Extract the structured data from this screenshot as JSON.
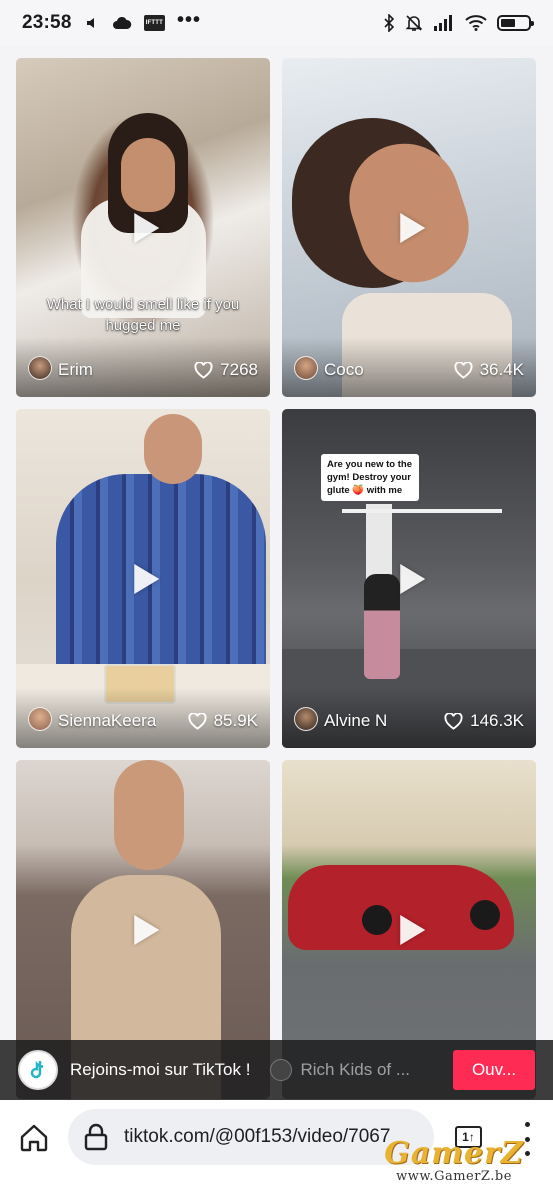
{
  "status_bar": {
    "time": "23:58",
    "ifttt_label": "IFTTT",
    "more": "•••",
    "battery_level": 0.55,
    "left_icons": [
      "volume-muted-icon",
      "cloud-icon",
      "ifttt-icon",
      "more-icon"
    ],
    "right_icons": [
      "bluetooth-icon",
      "bell-off-icon",
      "signal-icon",
      "wifi-icon",
      "battery-icon"
    ]
  },
  "videos": [
    {
      "username": "Erim",
      "likes": "7268",
      "caption": "What I would smell like if you hugged me",
      "colors": [
        "#c7b29b",
        "#e6ddd2",
        "#3b2e26"
      ]
    },
    {
      "username": "Coco",
      "likes": "36.4K",
      "caption": "",
      "colors": [
        "#d8dde3",
        "#b8876c",
        "#5a3a2a"
      ]
    },
    {
      "username": "SiennaKeera",
      "likes": "85.9K",
      "caption": "",
      "colors": [
        "#e8e2da",
        "#3f5fa8",
        "#2c3d78"
      ]
    },
    {
      "username": "Alvine N",
      "likes": "146.3K",
      "caption": "Are you new to the gym! Destroy your glute 🍑 with me",
      "colors": [
        "#4a4b4e",
        "#7c7d80",
        "#2e2f33"
      ]
    },
    {
      "username": "",
      "likes": "",
      "caption": "",
      "colors": [
        "#8c7d72",
        "#c4a58a",
        "#5b4940"
      ]
    },
    {
      "username": "",
      "likes": "",
      "caption": "",
      "colors": [
        "#d9cfb8",
        "#57733f",
        "#b3212b"
      ]
    }
  ],
  "banner": {
    "text": "Rejoins-moi sur TikTok !",
    "next_item": "Rich Kids of ...",
    "open_label": "Ouv..."
  },
  "browser": {
    "url": "tiktok.com/@00f153/video/7067",
    "tab_count": "1↑"
  },
  "watermark": {
    "brand": "GamerZ",
    "site": "www.GamerZ.be"
  },
  "colors": {
    "tiktok_red": "#fe2c55",
    "banner_bg": "#1e1e20",
    "urlbar_bg": "#eeeff2"
  }
}
